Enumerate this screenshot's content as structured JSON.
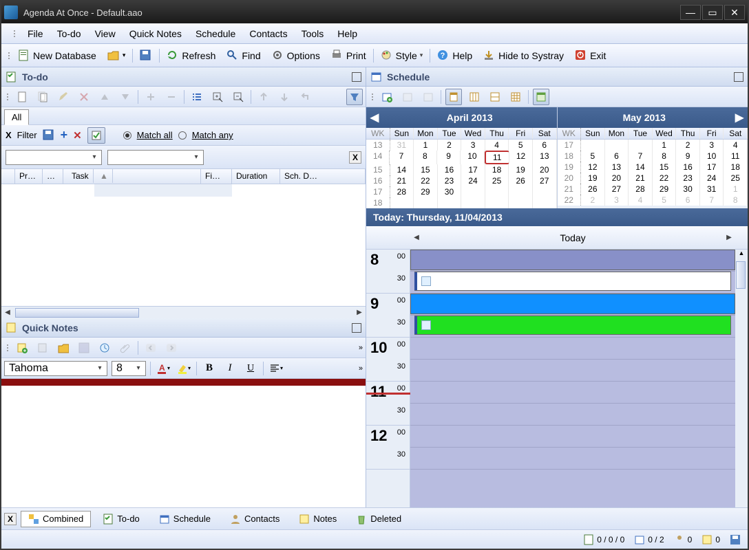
{
  "window": {
    "title": "Agenda At Once - Default.aao"
  },
  "menu": {
    "file": "File",
    "todo": "To-do",
    "view": "View",
    "quicknotes": "Quick Notes",
    "schedule": "Schedule",
    "contacts": "Contacts",
    "tools": "Tools",
    "help": "Help"
  },
  "toolbar": {
    "newdb": "New Database",
    "refresh": "Refresh",
    "find": "Find",
    "options": "Options",
    "print": "Print",
    "style": "Style",
    "help": "Help",
    "hide": "Hide to Systray",
    "exit": "Exit"
  },
  "todo": {
    "title": "To-do",
    "tab_all": "All",
    "filter_label": "Filter",
    "match_all": "Match all",
    "match_any": "Match any",
    "cols": {
      "pr": "Pr…",
      "dots": "…",
      "task": "Task",
      "sort": "▲",
      "fi": "Fi…",
      "duration": "Duration",
      "schd": "Sch. D…"
    }
  },
  "qn": {
    "title": "Quick Notes",
    "font": "Tahoma",
    "size": "8"
  },
  "sched": {
    "title": "Schedule",
    "month1": "April 2013",
    "month2": "May 2013",
    "dows": [
      "WK",
      "Sun",
      "Mon",
      "Tue",
      "Wed",
      "Thu",
      "Fri",
      "Sat"
    ],
    "apr": [
      [
        "13",
        "31",
        "1",
        "2",
        "3",
        "4",
        "5",
        "6"
      ],
      [
        "14",
        "7",
        "8",
        "9",
        "10",
        "11",
        "12",
        "13"
      ],
      [
        "15",
        "14",
        "15",
        "16",
        "17",
        "18",
        "19",
        "20"
      ],
      [
        "16",
        "21",
        "22",
        "23",
        "24",
        "25",
        "26",
        "27"
      ],
      [
        "17",
        "28",
        "29",
        "30",
        "",
        "",
        "",
        ""
      ],
      [
        "18",
        "",
        "",
        "",
        "",
        "",
        "",
        ""
      ]
    ],
    "may": [
      [
        "17",
        "",
        "",
        "",
        "1",
        "2",
        "3",
        "4"
      ],
      [
        "18",
        "5",
        "6",
        "7",
        "8",
        "9",
        "10",
        "11"
      ],
      [
        "19",
        "12",
        "13",
        "14",
        "15",
        "16",
        "17",
        "18"
      ],
      [
        "20",
        "19",
        "20",
        "21",
        "22",
        "23",
        "24",
        "25"
      ],
      [
        "21",
        "26",
        "27",
        "28",
        "29",
        "30",
        "31",
        "1"
      ],
      [
        "22",
        "2",
        "3",
        "4",
        "5",
        "6",
        "7",
        "8"
      ]
    ],
    "today_bar": "Today: Thursday, 11/04/2013",
    "day_label": "Today",
    "hours": [
      "8",
      "9",
      "10",
      "11",
      "12"
    ],
    "minute0": "00",
    "minute30": "30"
  },
  "tabs": {
    "x": "X",
    "combined": "Combined",
    "todo": "To-do",
    "schedule": "Schedule",
    "contacts": "Contacts",
    "notes": "Notes",
    "deleted": "Deleted"
  },
  "status": {
    "s1": "0 / 0 / 0",
    "s2": "0 / 2",
    "s3": "0",
    "s4": "0"
  }
}
